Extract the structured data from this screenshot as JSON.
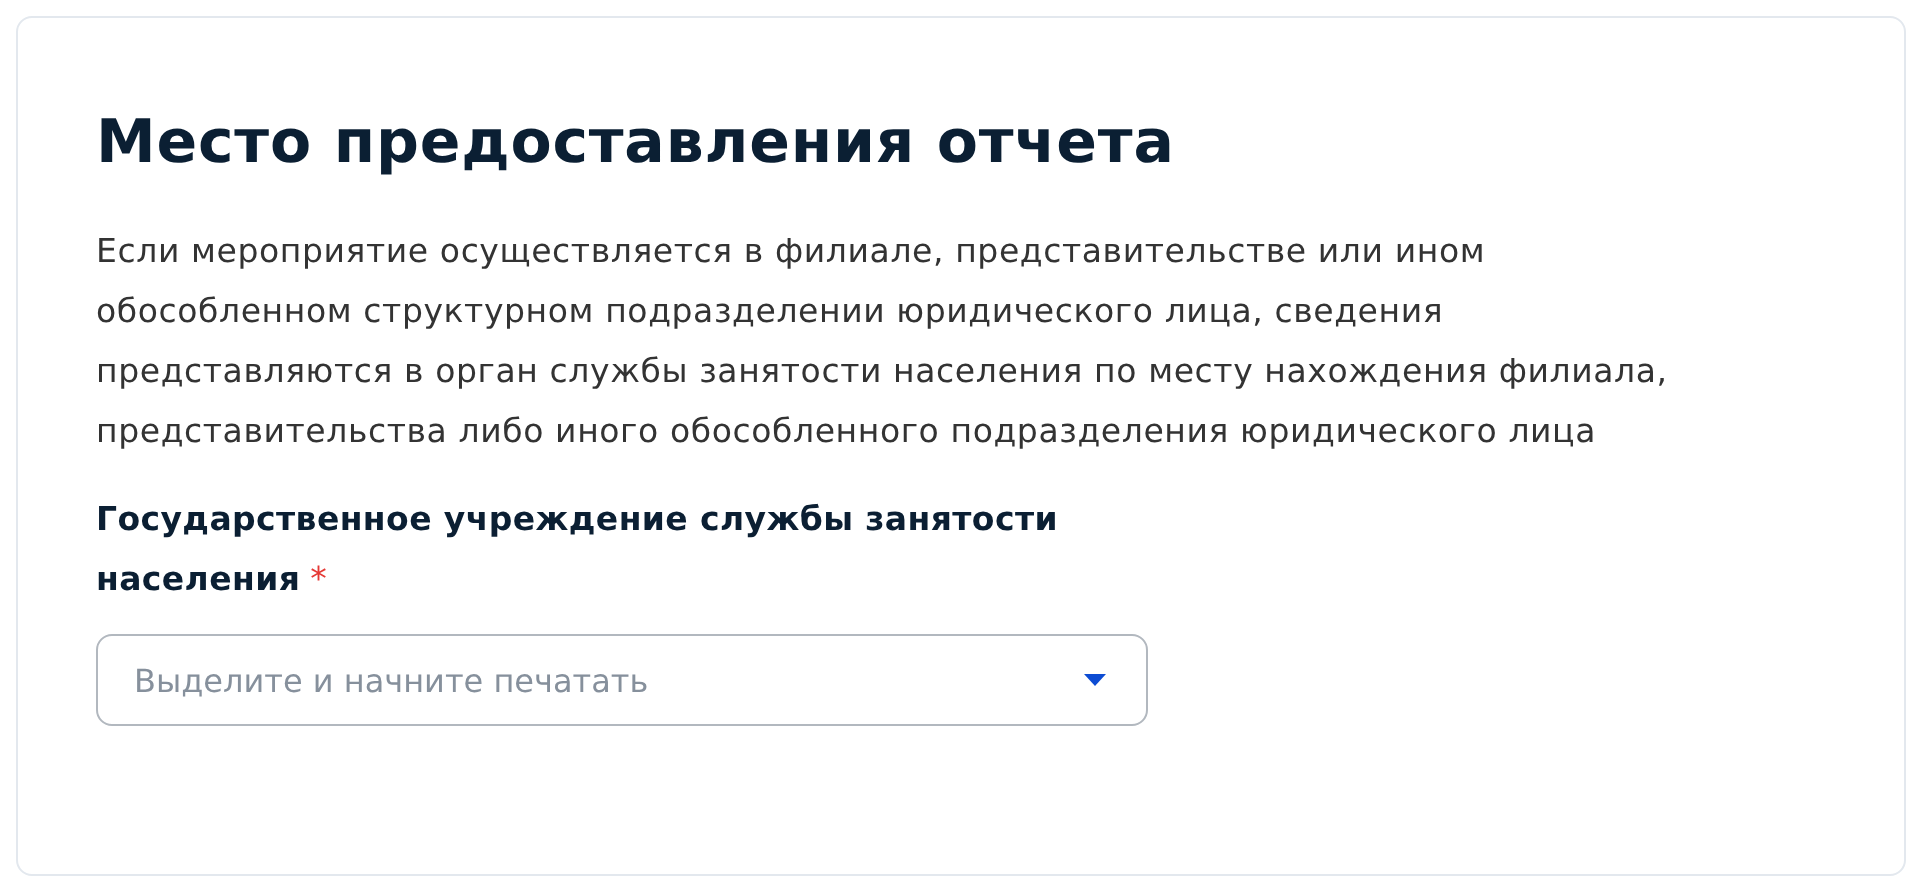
{
  "card": {
    "title": "Место предоставления отчета",
    "description": "Если мероприятие осуществляется в филиале, представительстве или ином обособленном структурном подразделении юридического лица, сведения представляются в орган службы занятости населения по месту нахождения филиала, представительства либо иного обособленного подразделения юридического лица",
    "field": {
      "label": "Государственное учреждение службы занятости населения",
      "required_mark": "*",
      "placeholder": "Выделите и начните печатать"
    }
  }
}
